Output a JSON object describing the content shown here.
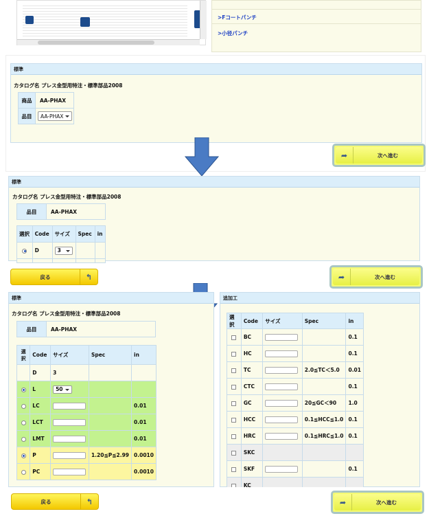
{
  "top": {
    "links": [
      ">Fコートパンチ",
      ">小径パンチ"
    ]
  },
  "step1": {
    "header": "標準",
    "catalog": "カタログ名 プレス金型用特注・標準部品2008",
    "product_label": "商品",
    "product_value": "AA-PHAX",
    "item_label": "品目",
    "item_select": "AA-PHAX",
    "next_label": "次へ進む"
  },
  "step2": {
    "header": "標準",
    "catalog": "カタログ名 プレス金型用特注・標準部品2008",
    "item_label": "品目",
    "item_value": "AA-PHAX",
    "cols": [
      "選択",
      "Code",
      "サイズ",
      "Spec",
      "in"
    ],
    "row_code": "D",
    "row_size": "3",
    "back_label": "戻る",
    "next_label": "次へ進む"
  },
  "step3": {
    "header": "標準",
    "catalog": "カタログ名 プレス金型用特注・標準部品2008",
    "item_label": "品目",
    "item_value": "AA-PHAX",
    "col_select": "選択",
    "col_code": "Code",
    "col_size": "サイズ",
    "col_spec": "Spec",
    "col_in": "in",
    "rows": [
      {
        "code": "D",
        "size": "3",
        "spec": "",
        "in": ""
      },
      {
        "code": "L",
        "size": "50",
        "spec": "",
        "in": ""
      },
      {
        "code": "LC",
        "size": "",
        "spec": "",
        "in": "0.01"
      },
      {
        "code": "LCT",
        "size": "",
        "spec": "",
        "in": "0.01"
      },
      {
        "code": "LMT",
        "size": "",
        "spec": "",
        "in": "0.01"
      },
      {
        "code": "P",
        "size": "",
        "spec": "1.20≦P≦2.99",
        "in": "0.0010"
      },
      {
        "code": "PC",
        "size": "",
        "spec": "",
        "in": "0.0010"
      }
    ],
    "back_label": "戻る",
    "next_label": "次へ進む"
  },
  "extra": {
    "header": "追加工",
    "cols": [
      "選択",
      "Code",
      "サイズ",
      "Spec",
      "in"
    ],
    "rows": [
      {
        "code": "BC",
        "spec": "",
        "in": "0.1"
      },
      {
        "code": "HC",
        "spec": "",
        "in": "0.1"
      },
      {
        "code": "TC",
        "spec": "2.0≦TC＜5.0",
        "in": "0.01"
      },
      {
        "code": "CTC",
        "spec": "",
        "in": "0.1"
      },
      {
        "code": "GC",
        "spec": "20≦GC＜90",
        "in": "1.0"
      },
      {
        "code": "HCC",
        "spec": "0.1≦HCC≦1.0",
        "in": "0.1"
      },
      {
        "code": "HRC",
        "spec": "0.1≦HRC≦1.0",
        "in": "0.1"
      },
      {
        "code": "SKC",
        "spec": "",
        "in": ""
      },
      {
        "code": "SKF",
        "spec": "",
        "in": "0.1"
      },
      {
        "code": "KC",
        "spec": "",
        "in": ""
      }
    ]
  },
  "colors": {
    "header": "#dbeefa",
    "panel": "#fbfbe9",
    "green": "#c3f28f",
    "yellow": "#fcf6a0",
    "arrow": "#4a7bc4"
  }
}
